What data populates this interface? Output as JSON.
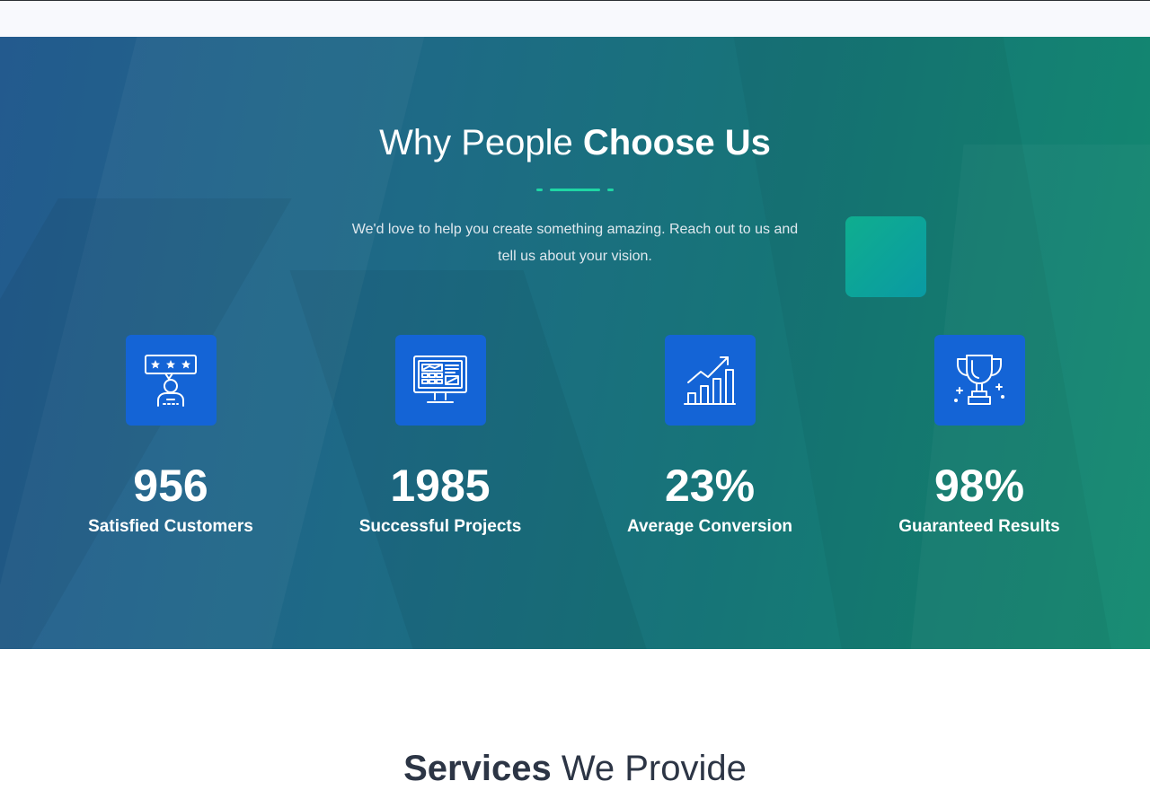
{
  "section": {
    "title_light": "Why People ",
    "title_bold": "Choose Us",
    "subtitle": "We'd love to help you create something amazing. Reach out to us and tell us about your vision."
  },
  "stats": [
    {
      "icon": "customer-rating-icon",
      "value": "956",
      "label": "Satisfied Customers"
    },
    {
      "icon": "monitor-dashboard-icon",
      "value": "1985",
      "label": "Successful Projects"
    },
    {
      "icon": "growth-chart-icon",
      "value": "23%",
      "label": "Average Conversion"
    },
    {
      "icon": "trophy-icon",
      "value": "98%",
      "label": "Guaranteed Results"
    }
  ],
  "next_section": {
    "title_bold": "Services",
    "title_light": " We Provide"
  },
  "colors": {
    "accent": "#1fd6a4",
    "icon_box": "#1464d6",
    "gradient_start": "#235a8e",
    "gradient_end": "#128a6f"
  }
}
